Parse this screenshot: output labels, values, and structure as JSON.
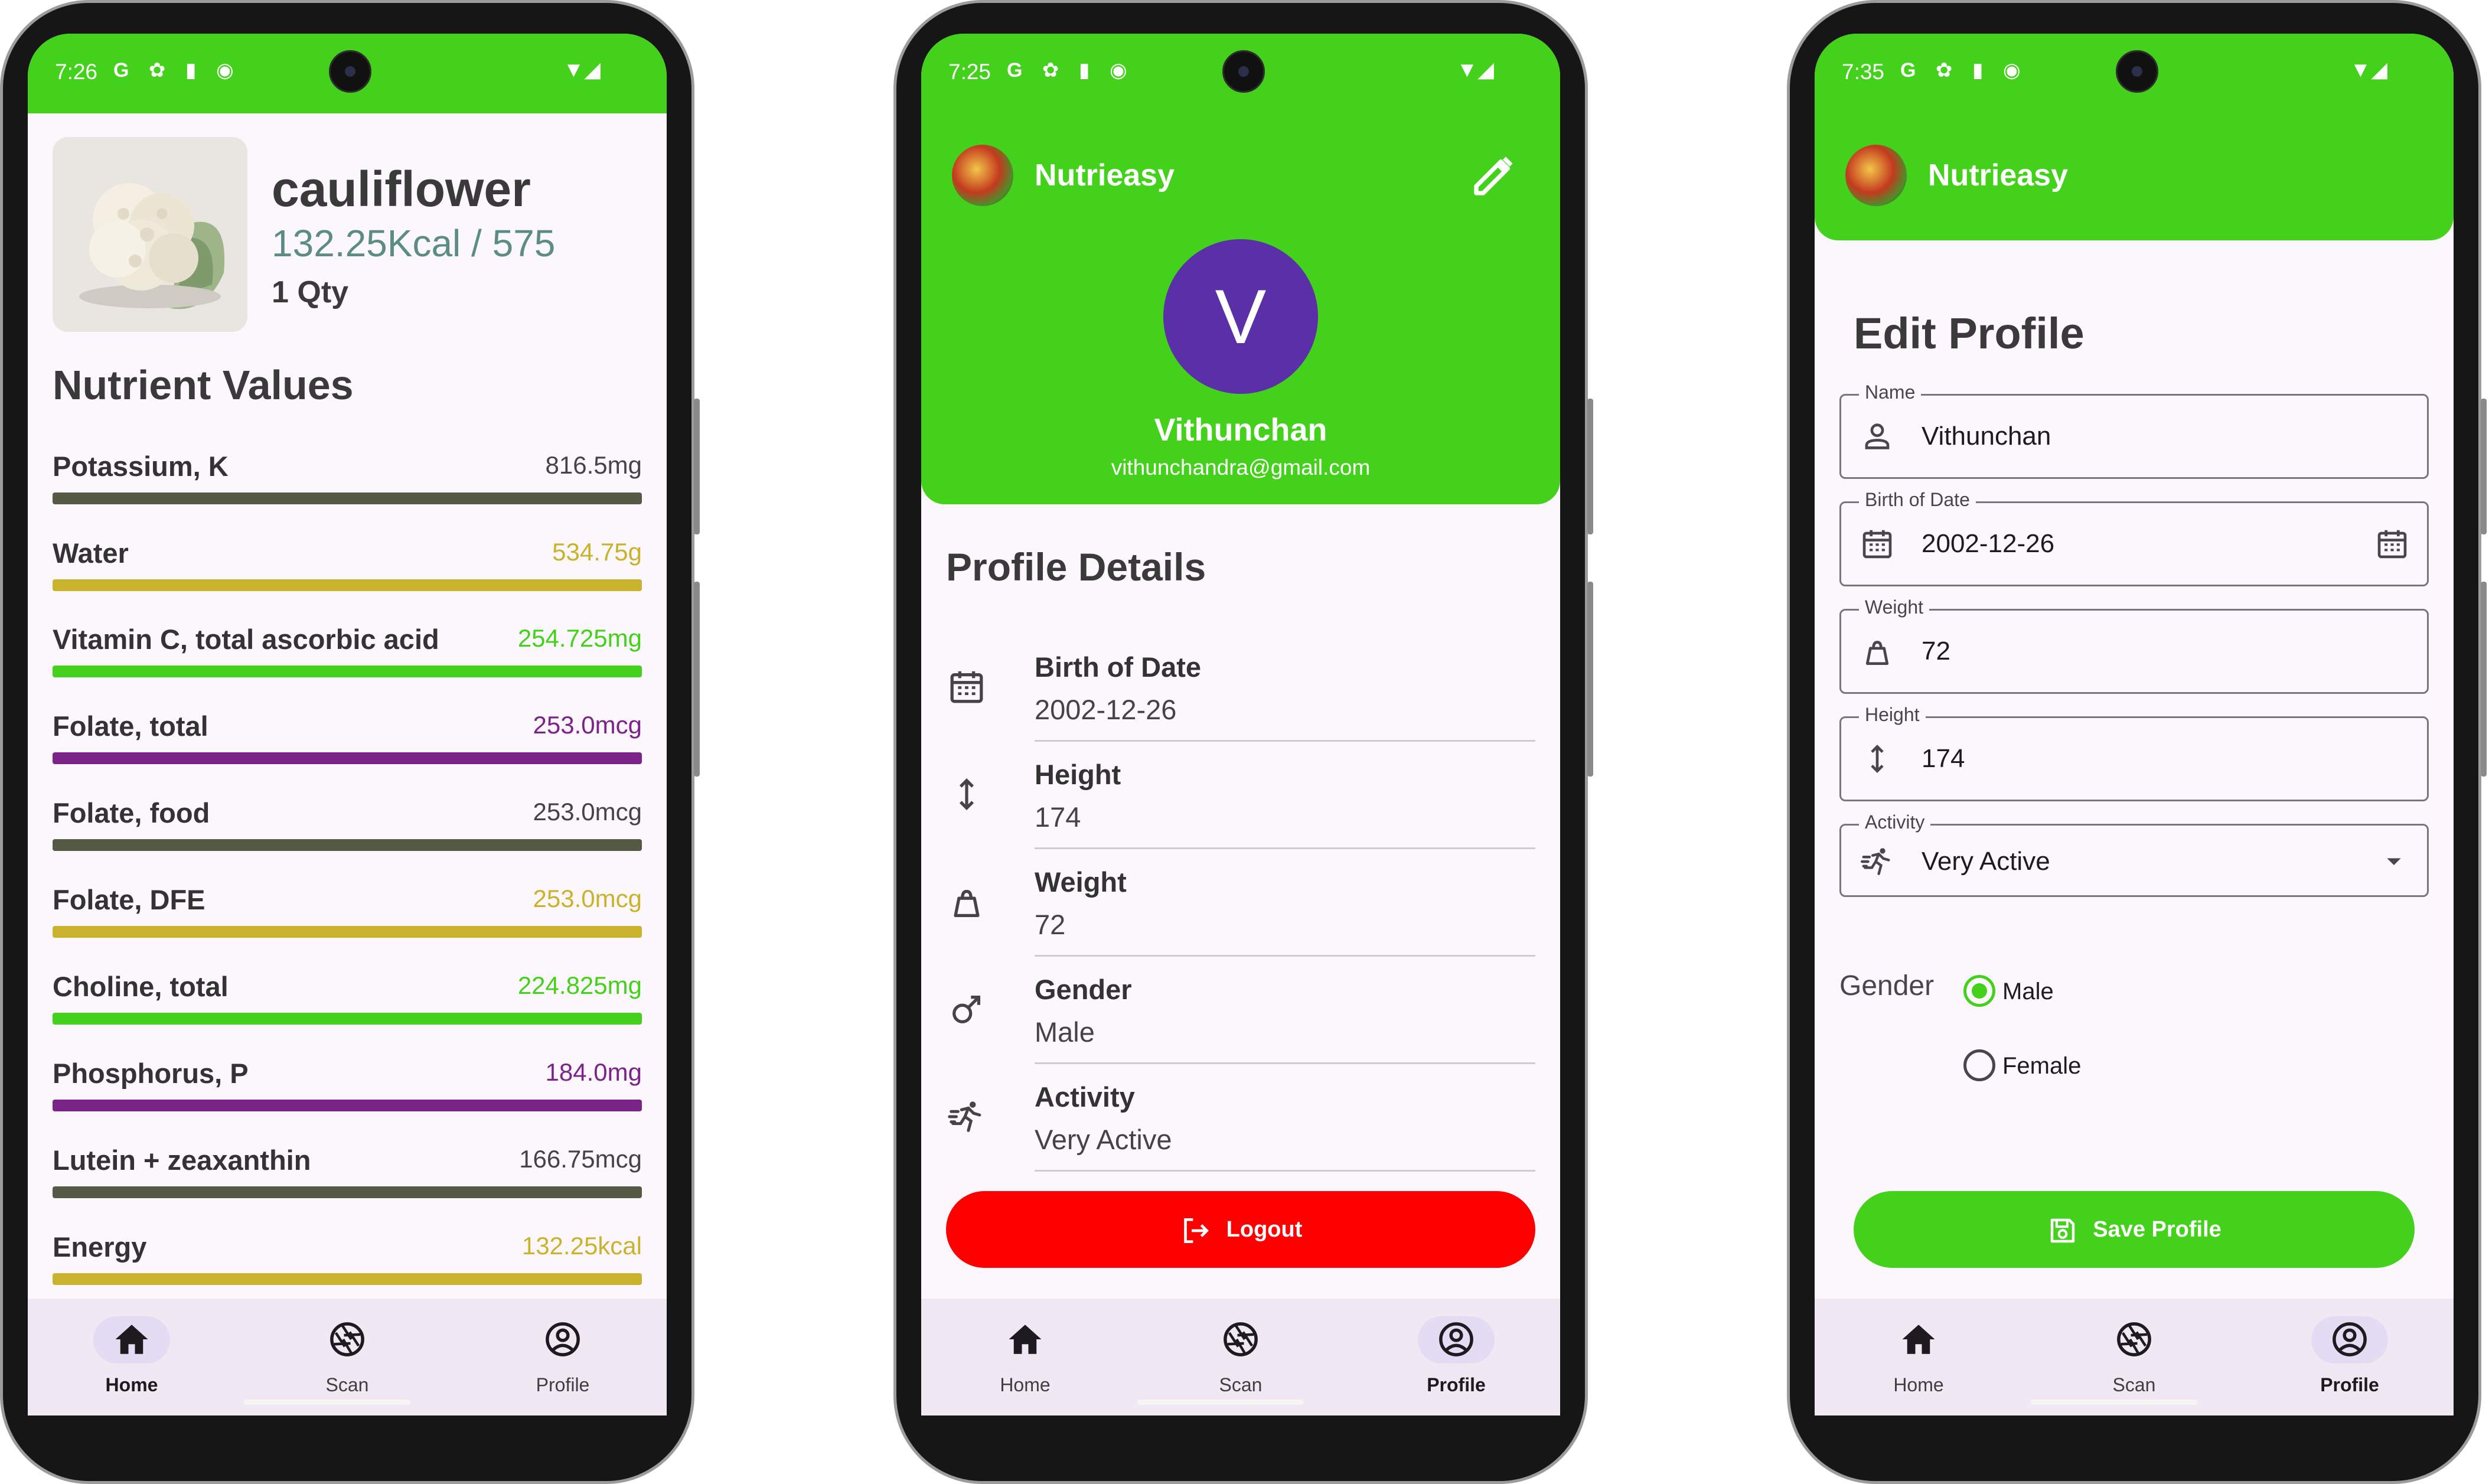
{
  "status": {
    "p1_time": "7:26",
    "p2_time": "7:25",
    "p3_time": "7:35",
    "icons": "G ✿ ▮ ◉"
  },
  "app": {
    "name": "Nutrieasy"
  },
  "colors": {
    "primary": "#43d11b",
    "logout": "#ff0000",
    "avatar": "#5a2fa8",
    "kcal": "#5b8c85"
  },
  "food": {
    "name": "cauliflower",
    "kcal": "132.25Kcal / 575",
    "qty": "1 Qty",
    "section_title": "Nutrient Values",
    "nutrients": [
      {
        "name": "Potassium, K",
        "value": "816.5mg",
        "color": "#555a45"
      },
      {
        "name": "Water",
        "value": "534.75g",
        "color": "#c9b32c"
      },
      {
        "name": "Vitamin C, total ascorbic acid",
        "value": "254.725mg",
        "color": "#43d11b"
      },
      {
        "name": "Folate, total",
        "value": "253.0mcg",
        "color": "#7b2389"
      },
      {
        "name": "Folate, food",
        "value": "253.0mcg",
        "color": "#555a45"
      },
      {
        "name": "Folate, DFE",
        "value": "253.0mcg",
        "color": "#c9b32c"
      },
      {
        "name": "Choline, total",
        "value": "224.825mg",
        "color": "#43d11b"
      },
      {
        "name": "Phosphorus, P",
        "value": "184.0mg",
        "color": "#7b2389"
      },
      {
        "name": "Lutein + zeaxanthin",
        "value": "166.75mcg",
        "color": "#555a45"
      },
      {
        "name": "Energy",
        "value": "132.25kcal",
        "color": "#c9b32c"
      }
    ]
  },
  "profile": {
    "avatar_letter": "V",
    "name": "Vithunchan",
    "email": "vithunchandra@gmail.com",
    "section_title": "Profile Details",
    "details": [
      {
        "label": "Birth of Date",
        "value": "2002-12-26",
        "icon": "calendar-icon"
      },
      {
        "label": "Height",
        "value": "174",
        "icon": "height-icon"
      },
      {
        "label": "Weight",
        "value": "72",
        "icon": "weight-icon"
      },
      {
        "label": "Gender",
        "value": "Male",
        "icon": "male-icon"
      },
      {
        "label": "Activity",
        "value": "Very Active",
        "icon": "running-icon"
      }
    ],
    "logout_label": "Logout"
  },
  "edit": {
    "title": "Edit Profile",
    "fields": [
      {
        "label": "Name",
        "value": "Vithunchan"
      },
      {
        "label": "Birth of Date",
        "value": "2002-12-26"
      },
      {
        "label": "Weight",
        "value": "72"
      },
      {
        "label": "Height",
        "value": "174"
      },
      {
        "label": "Activity",
        "value": "Very Active"
      }
    ],
    "gender_label": "Gender",
    "gender_options": [
      "Male",
      "Female"
    ],
    "selected_gender": "Male",
    "save_label": "Save Profile"
  },
  "nav": {
    "items": [
      "Home",
      "Scan",
      "Profile"
    ],
    "p1_active": "Home",
    "p2_active": "Profile",
    "p3_active": "Profile"
  }
}
